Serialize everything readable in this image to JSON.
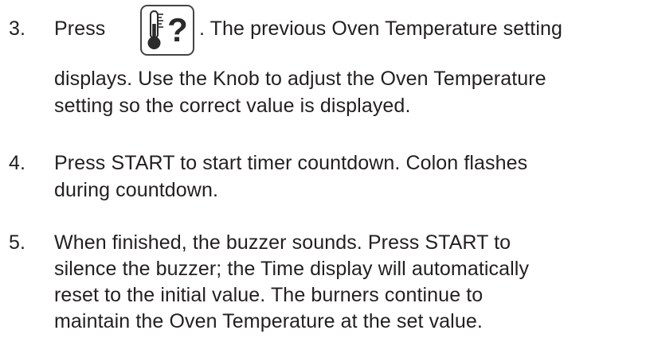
{
  "steps": [
    {
      "number": "3.",
      "press_label": "Press",
      "icon": "thermometer-question-icon",
      "after_icon": ". The previous Oven Temperature setting",
      "lines": [
        "displays. Use the Knob to adjust the Oven Temperature",
        "setting so the correct value is displayed."
      ]
    },
    {
      "number": "4.",
      "lines": [
        "Press START to start timer countdown. Colon flashes",
        "during countdown."
      ]
    },
    {
      "number": "5.",
      "lines": [
        "When finished, the buzzer sounds. Press START to",
        "silence the buzzer; the Time display will automatically",
        "reset to the initial value.  The burners continue to",
        "maintain the Oven Temperature at the set value."
      ]
    }
  ]
}
